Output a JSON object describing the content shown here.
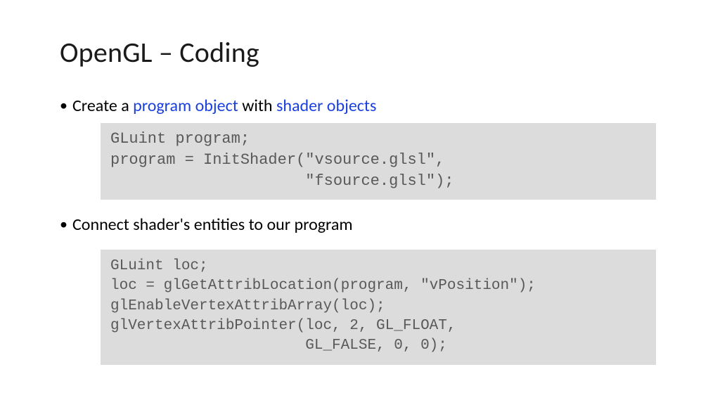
{
  "title": "OpenGL – Coding",
  "bullet1": {
    "pre": "Create a ",
    "kw1": "program object",
    "mid": " with ",
    "kw2": "shader objects"
  },
  "code1": "GLuint program;\nprogram = InitShader(\"vsource.glsl\",\n                     \"fsource.glsl\");",
  "bullet2": "Connect shader's entities to our program",
  "code2": "GLuint loc;\nloc = glGetAttribLocation(program, \"vPosition\");\nglEnableVertexAttribArray(loc);\nglVertexAttribPointer(loc, 2, GL_FLOAT,\n                      GL_FALSE, 0, 0);"
}
